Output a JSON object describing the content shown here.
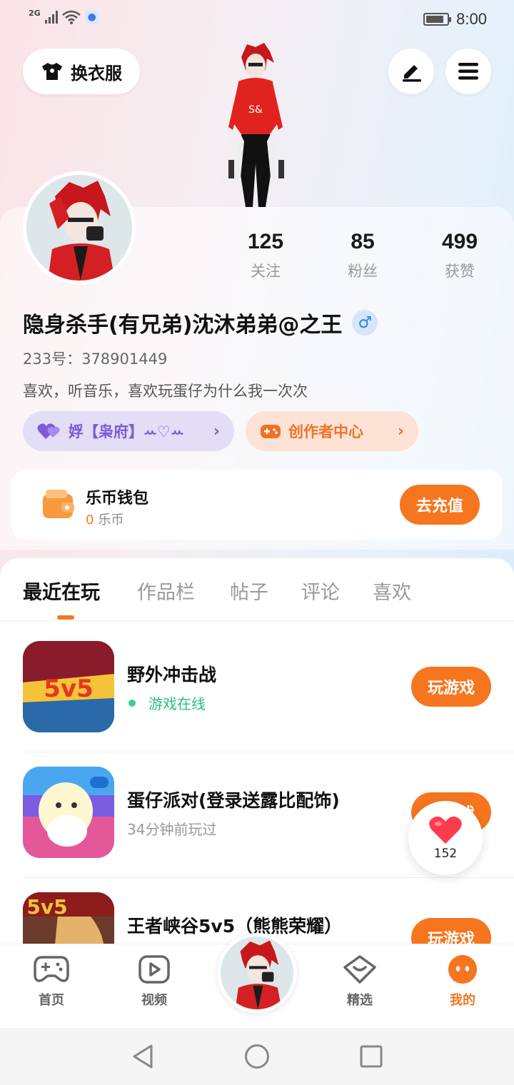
{
  "status_bar": {
    "network": "2G",
    "time": "8:00",
    "battery_level": 0.85
  },
  "header": {
    "outfit_label": "换衣服"
  },
  "profile": {
    "stats": [
      {
        "value": "125",
        "label": "关注"
      },
      {
        "value": "85",
        "label": "粉丝"
      },
      {
        "value": "499",
        "label": "获赞"
      }
    ],
    "username": "隐身杀手(有兄弟)沈沐弟弟@之王",
    "gender_symbol": "♂",
    "user_id": "233号：378901449",
    "bio": "喜欢，听音乐，喜欢玩蛋仔为什么我一次次",
    "family_chip": {
      "label": "娐【枭府】ꕀ♡ꕀ",
      "arrow": "›"
    },
    "creator_chip": {
      "label": "创作者中心",
      "arrow": "›"
    }
  },
  "wallet": {
    "title": "乐币钱包",
    "balance": "0",
    "unit": "乐币",
    "recharge_label": "去充值"
  },
  "tabs": [
    "最近在玩",
    "作品栏",
    "帖子",
    "评论",
    "喜欢"
  ],
  "games": [
    {
      "name": "野外冲击战",
      "status": "游戏在线",
      "online": true,
      "button": "玩游戏",
      "badge": "5v5"
    },
    {
      "name": "蛋仔派对(登录送露比配饰)",
      "status": "34分钟前玩过",
      "online": false,
      "button": "玩游戏",
      "badge": ""
    },
    {
      "name": "王者峡谷5v5（熊熊荣耀）",
      "status": "",
      "online": false,
      "button": "玩游戏",
      "badge": "5v5"
    }
  ],
  "like_float": {
    "count": "152"
  },
  "bottom_nav": [
    {
      "label": "首页",
      "icon": "gamepad-icon"
    },
    {
      "label": "视频",
      "icon": "video-icon"
    },
    {
      "label": "精选",
      "icon": "featured-icon"
    },
    {
      "label": "我的",
      "icon": "profile-face-icon"
    }
  ],
  "colors": {
    "accent": "#f5761f",
    "online": "#2dbd7e",
    "family": "#7b5cd6"
  }
}
